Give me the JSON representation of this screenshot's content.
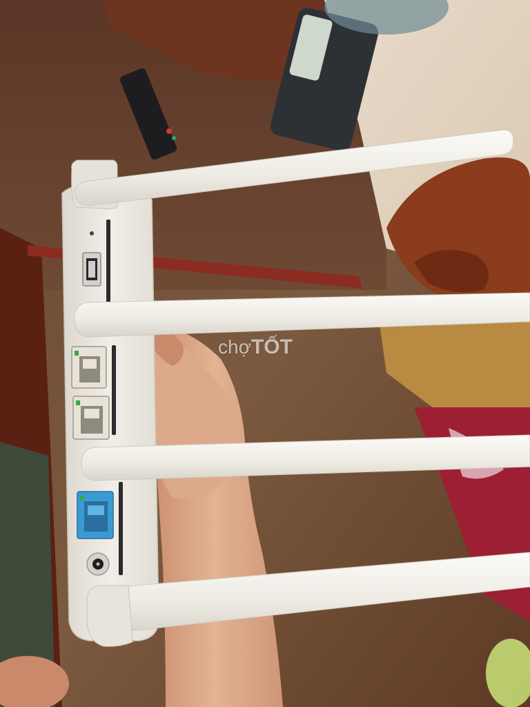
{
  "watermark": {
    "prefix": "chợ",
    "brand": "TỐT"
  },
  "colors": {
    "router_body": "#ece9e2",
    "antenna": "#f0eee8",
    "lan_port": "#e8e3d6",
    "wan_port": "#3a9ad4",
    "table_wood": "#6a3a20",
    "tablecloth": "#a8203a",
    "skin": "#d9a584"
  },
  "router": {
    "antenna_count": 4,
    "ports": [
      "usb",
      "lan",
      "lan",
      "wan",
      "power"
    ]
  }
}
